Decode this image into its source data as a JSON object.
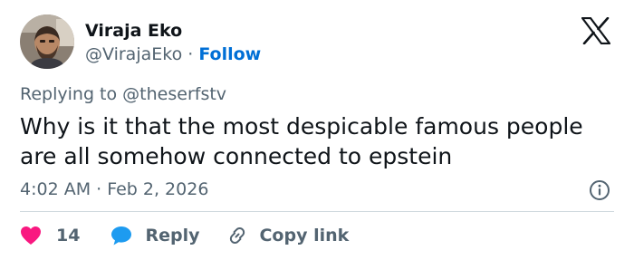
{
  "author": {
    "display_name": "Viraja Eko",
    "handle": "@VirajaEko",
    "separator": "·",
    "follow_label": "Follow"
  },
  "reply_context": {
    "prefix": "Replying to",
    "mention": "@theserfstv"
  },
  "tweet": {
    "text": "Why is it that the most despicable famous people are all somehow connected to epstein",
    "timestamp": "4:02 AM · Feb 2, 2026"
  },
  "actions": {
    "like_count": "14",
    "reply_label": "Reply",
    "copy_link_label": "Copy link"
  },
  "icons": {
    "brand": "x-logo-icon",
    "info": "info-icon",
    "like": "heart-icon",
    "reply": "speech-bubble-icon",
    "copy": "link-icon"
  },
  "colors": {
    "text": "#0f1419",
    "muted": "#536471",
    "link": "#006fd6",
    "like": "#f91880",
    "reply": "#1d9bf0",
    "divider": "#cfd9de"
  }
}
